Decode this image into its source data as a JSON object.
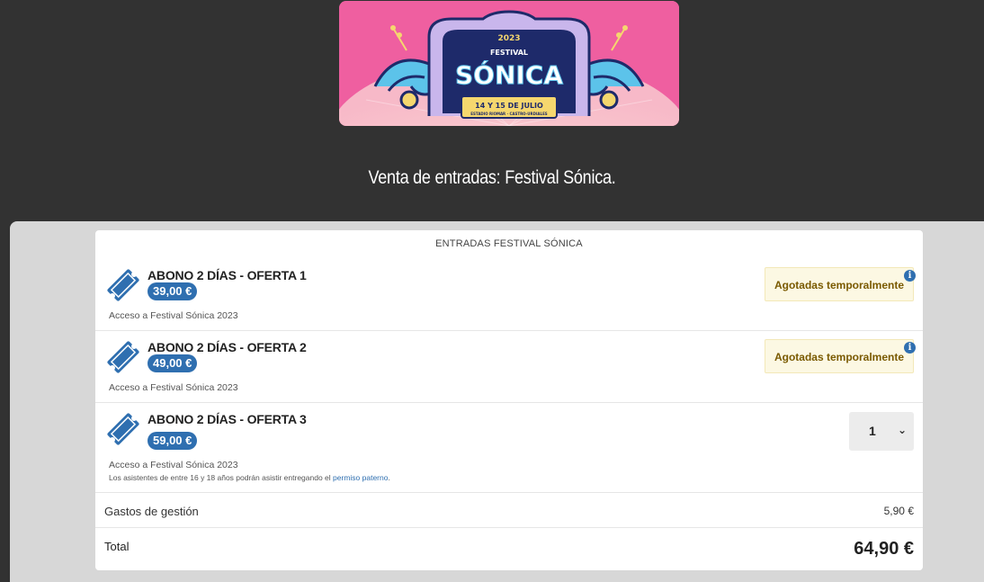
{
  "banner": {
    "year": "2023",
    "festival_word": "FESTIVAL",
    "name": "SÓNICA",
    "dates": "14 Y 15 DE JULIO",
    "venue": "ESTADIO RIOMAR · CASTRO-URDIALES"
  },
  "page": {
    "title": "Venta de entradas: Festival Sónica."
  },
  "card": {
    "header": "ENTRADAS FESTIVAL SÓNICA",
    "tickets": [
      {
        "name": "ABONO 2 DÍAS - OFERTA 1",
        "price": "39,00 €",
        "description": "Acceso a Festival Sónica 2023",
        "status": "Agotadas temporalmente"
      },
      {
        "name": "ABONO 2 DÍAS - OFERTA 2",
        "price": "49,00 €",
        "description": "Acceso a Festival Sónica 2023",
        "status": "Agotadas temporalmente"
      },
      {
        "name": "ABONO 2 DÍAS - OFERTA 3",
        "price": "59,00 €",
        "description": "Acceso a Festival Sónica 2023",
        "note_prefix": "Los asistentes de entre 16 y 18 años podrán asistir entregando el",
        "note_link": "permiso paterno",
        "note_suffix": ".",
        "quantity": "1"
      }
    ],
    "fees": {
      "label": "Gastos de gestión",
      "value": "5,90 €"
    },
    "total": {
      "label": "Total",
      "value": "64,90 €"
    }
  },
  "colors": {
    "background": "#323232",
    "accent": "#2f6fb0",
    "soldout_bg": "#fcf8e3",
    "banner_pink": "#f06aa4"
  },
  "icons": {
    "ticket": "ticket-icon",
    "info": "info-icon",
    "chevron": "chevron-down-icon"
  }
}
